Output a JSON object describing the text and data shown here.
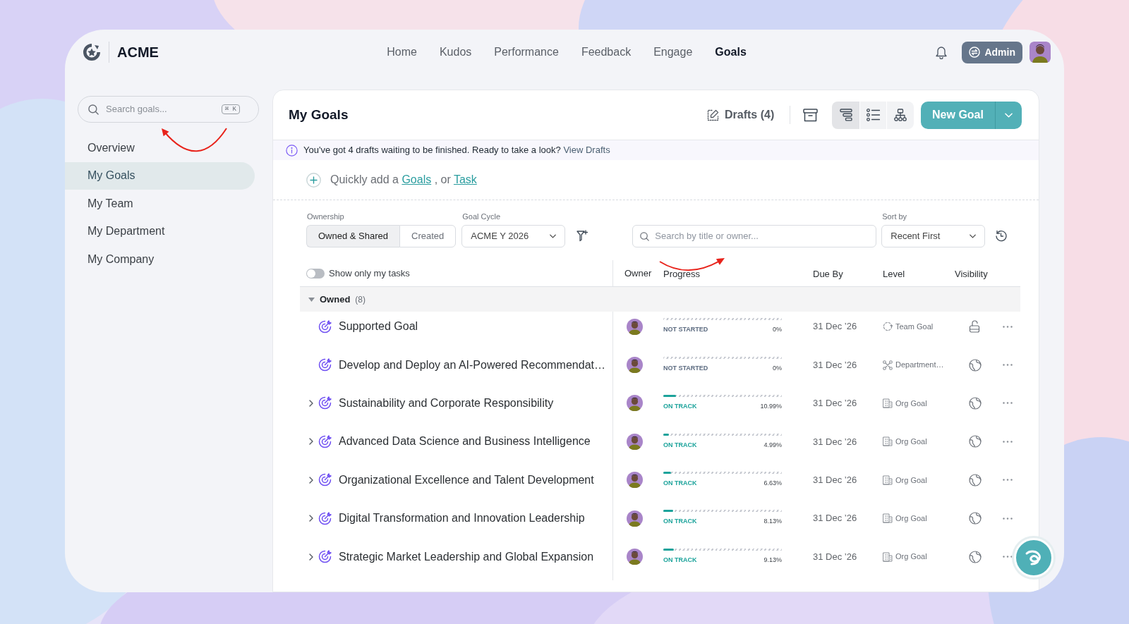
{
  "header": {
    "brand": "ACME",
    "nav": [
      {
        "label": "Home",
        "selected": false
      },
      {
        "label": "Kudos",
        "selected": false
      },
      {
        "label": "Performance",
        "selected": false
      },
      {
        "label": "Feedback",
        "selected": false
      },
      {
        "label": "Engage",
        "selected": false
      },
      {
        "label": "Goals",
        "selected": true
      }
    ],
    "admin_button": "Admin"
  },
  "sidebar": {
    "search": {
      "placeholder": "Search goals...",
      "shortcut": "⌘ K"
    },
    "items": [
      {
        "label": "Overview",
        "selected": false
      },
      {
        "label": "My Goals",
        "selected": true
      },
      {
        "label": "My Team",
        "selected": false
      },
      {
        "label": "My Department",
        "selected": false
      },
      {
        "label": "My Company",
        "selected": false
      }
    ]
  },
  "page": {
    "title": "My Goals",
    "drafts_button": "Drafts (4)",
    "view_modes": [
      {
        "kind": "tree",
        "selected": true
      },
      {
        "kind": "list",
        "selected": false
      },
      {
        "kind": "org_chart",
        "selected": false
      }
    ],
    "new_goal_button": "New Goal"
  },
  "banner": {
    "text": "You've got 4 drafts waiting to be finished. Ready to take a look?",
    "link": "View Drafts"
  },
  "quick_add": {
    "text": "Quickly add a",
    "links": [
      "Goals",
      "Task"
    ],
    "joiner": ", or"
  },
  "filters": {
    "ownership": {
      "label": "Ownership",
      "options": [
        {
          "label": "Owned & Shared",
          "selected": true
        },
        {
          "label": "Created",
          "selected": false
        }
      ]
    },
    "goal_cycle": {
      "label": "Goal Cycle",
      "value": "ACME Y 2026"
    },
    "search": {
      "placeholder": "Search by title or owner..."
    },
    "sort": {
      "label": "Sort by",
      "value": "Recent First"
    }
  },
  "table": {
    "my_tasks_toggle": {
      "label": "Show only my tasks",
      "on": false
    },
    "columns": [
      "Owner",
      "Progress",
      "Due By",
      "Level",
      "Visibility"
    ],
    "group": {
      "label": "Owned",
      "count": "(8)",
      "expanded": true
    },
    "rows": [
      {
        "title": "Supported Goal",
        "expandable": false,
        "status": {
          "kind": "not_started",
          "label": "NOT STARTED"
        },
        "level": 0,
        "percent": "0%",
        "due": "31 Dec ’26",
        "goal_level": {
          "kind": "team",
          "label": "Team Goal"
        },
        "visibility": {
          "kind": "locked"
        }
      },
      {
        "title": "Develop and Deploy an AI-Powered Recommendat…",
        "expandable": false,
        "status": {
          "kind": "not_started",
          "label": "NOT STARTED"
        },
        "level": 0,
        "percent": "0%",
        "due": "31 Dec ’26",
        "goal_level": {
          "kind": "department",
          "label": "Department…"
        },
        "visibility": {
          "kind": "public"
        }
      },
      {
        "title": "Sustainability and Corporate Responsibility",
        "expandable": true,
        "status": {
          "kind": "on_track",
          "label": "ON TRACK"
        },
        "level": 0.1099,
        "percent": "10.99%",
        "due": "31 Dec ’26",
        "goal_level": {
          "kind": "org",
          "label": "Org Goal"
        },
        "visibility": {
          "kind": "public"
        }
      },
      {
        "title": "Advanced Data Science and Business Intelligence",
        "expandable": true,
        "status": {
          "kind": "on_track",
          "label": "ON TRACK"
        },
        "level": 0.0499,
        "percent": "4.99%",
        "due": "31 Dec ’26",
        "goal_level": {
          "kind": "org",
          "label": "Org Goal"
        },
        "visibility": {
          "kind": "public"
        }
      },
      {
        "title": "Organizational Excellence and Talent Development",
        "expandable": true,
        "status": {
          "kind": "on_track",
          "label": "ON TRACK"
        },
        "level": 0.0663,
        "percent": "6.63%",
        "due": "31 Dec ’26",
        "goal_level": {
          "kind": "org",
          "label": "Org Goal"
        },
        "visibility": {
          "kind": "public"
        }
      },
      {
        "title": "Digital Transformation and Innovation Leadership",
        "expandable": true,
        "status": {
          "kind": "on_track",
          "label": "ON TRACK"
        },
        "level": 0.0813,
        "percent": "8.13%",
        "due": "31 Dec ’26",
        "goal_level": {
          "kind": "org",
          "label": "Org Goal"
        },
        "visibility": {
          "kind": "public"
        }
      },
      {
        "title": "Strategic Market Leadership and Global Expansion",
        "expandable": true,
        "status": {
          "kind": "on_track",
          "label": "ON TRACK"
        },
        "level": 0.0913,
        "percent": "9.13%",
        "due": "31 Dec ’26",
        "goal_level": {
          "kind": "org",
          "label": "Org Goal"
        },
        "visibility": {
          "kind": "public"
        }
      }
    ]
  }
}
